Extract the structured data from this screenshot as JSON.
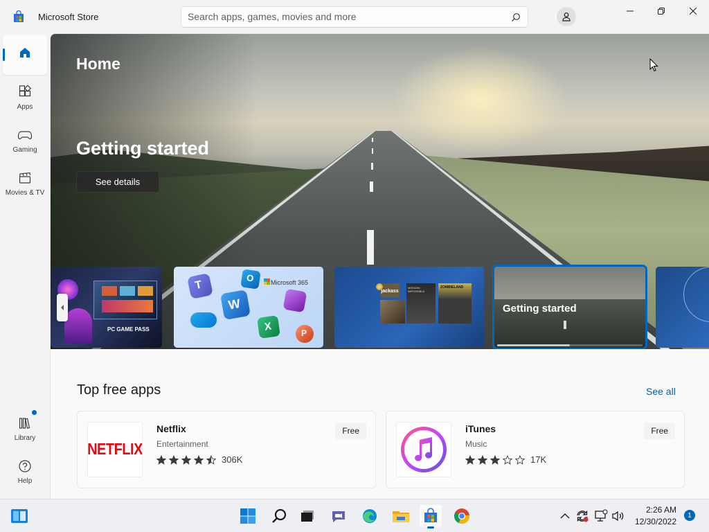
{
  "window": {
    "title": "Microsoft Store",
    "controls": {
      "minimize": "minimize",
      "maximize": "restore",
      "close": "close"
    }
  },
  "search": {
    "placeholder": "Search apps, games, movies and more",
    "value": ""
  },
  "sidebar": {
    "items": [
      {
        "label": "",
        "icon": "home-icon",
        "active": true
      },
      {
        "label": "Apps",
        "icon": "apps-icon"
      },
      {
        "label": "Gaming",
        "icon": "gamepad-icon"
      },
      {
        "label": "Movies & TV",
        "icon": "clapperboard-icon"
      }
    ],
    "bottom": [
      {
        "label": "Library",
        "icon": "library-icon",
        "badge": true
      },
      {
        "label": "Help",
        "icon": "help-icon"
      }
    ]
  },
  "hero": {
    "title": "Home",
    "heading": "Getting started",
    "button": "See details"
  },
  "carousel": {
    "items": [
      {
        "label": "PC GAME PASS"
      },
      {
        "label": "Microsoft 365"
      },
      {
        "label": "jackass",
        "movies": [
          "MISSION: IMPOSSIBLE",
          "ZOMBIELAND"
        ]
      },
      {
        "label": "Getting started",
        "selected": true,
        "progress": 0.5
      },
      {
        "label": ""
      }
    ]
  },
  "section": {
    "title": "Top free apps",
    "see_all": "See all",
    "apps": [
      {
        "name": "Netflix",
        "category": "Entertainment",
        "rating": 4.5,
        "count": "306K",
        "price": "Free",
        "logo_text": "NETFLIX"
      },
      {
        "name": "iTunes",
        "category": "Music",
        "rating": 3,
        "count": "17K",
        "price": "Free"
      }
    ]
  },
  "taskbar": {
    "clock": {
      "time": "2:26 AM",
      "date": "12/30/2022"
    },
    "notifications": "1"
  },
  "colors": {
    "accent": "#0067c0",
    "netflix_red": "#e50914",
    "window_bg": "#f3f3f3"
  }
}
